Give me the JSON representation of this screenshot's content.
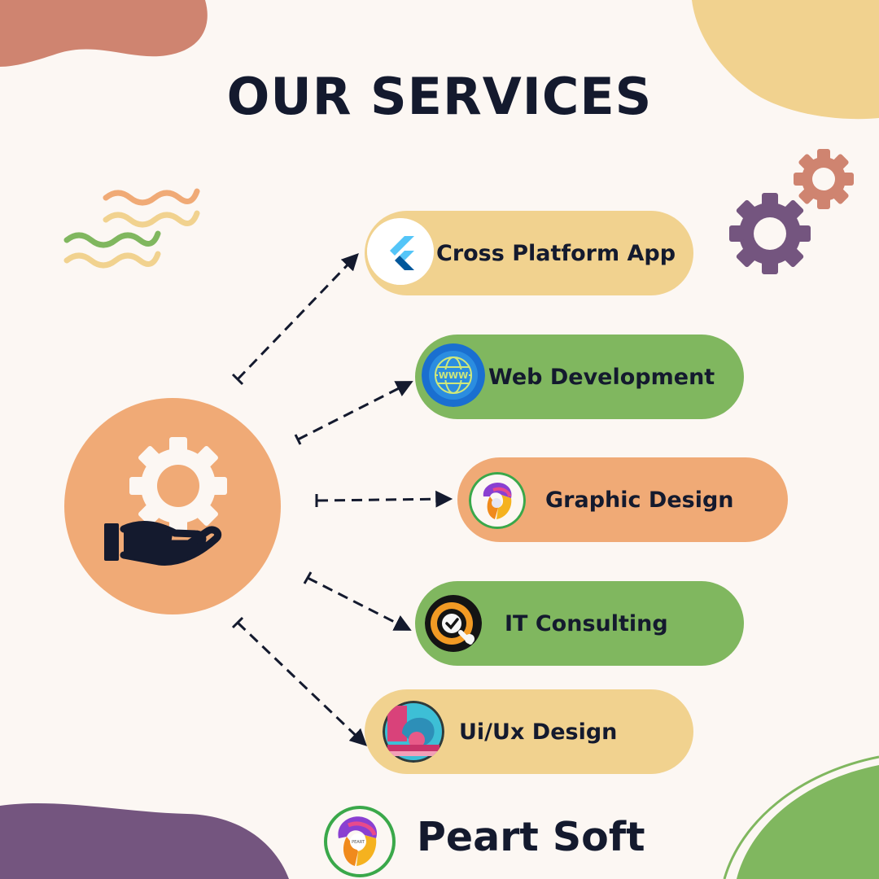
{
  "title": "OUR SERVICES",
  "services": [
    {
      "label": "Cross Platform App",
      "icon": "flutter-logo-icon",
      "color": "#f1d28f"
    },
    {
      "label": "Web Development",
      "icon": "globe-www-icon",
      "color": "#80b75f"
    },
    {
      "label": "Graphic Design",
      "icon": "graphic-design-logo-icon",
      "color": "#f0aa76"
    },
    {
      "label": "IT Consulting",
      "icon": "target-check-icon",
      "color": "#80b75f"
    },
    {
      "label": "Ui/Ux Design",
      "icon": "3d-shapes-icon",
      "color": "#f1d28f"
    }
  ],
  "brand": {
    "name": "Peart Soft",
    "logo_text": "PEART"
  },
  "center_icon": "hand-holding-gear-icon",
  "colors": {
    "background": "#fcf7f3",
    "text": "#141a2e",
    "peach": "#f0aa76",
    "yellow": "#f1d28f",
    "green": "#80b75f",
    "purple": "#74557f",
    "terracotta": "#cf8470"
  }
}
